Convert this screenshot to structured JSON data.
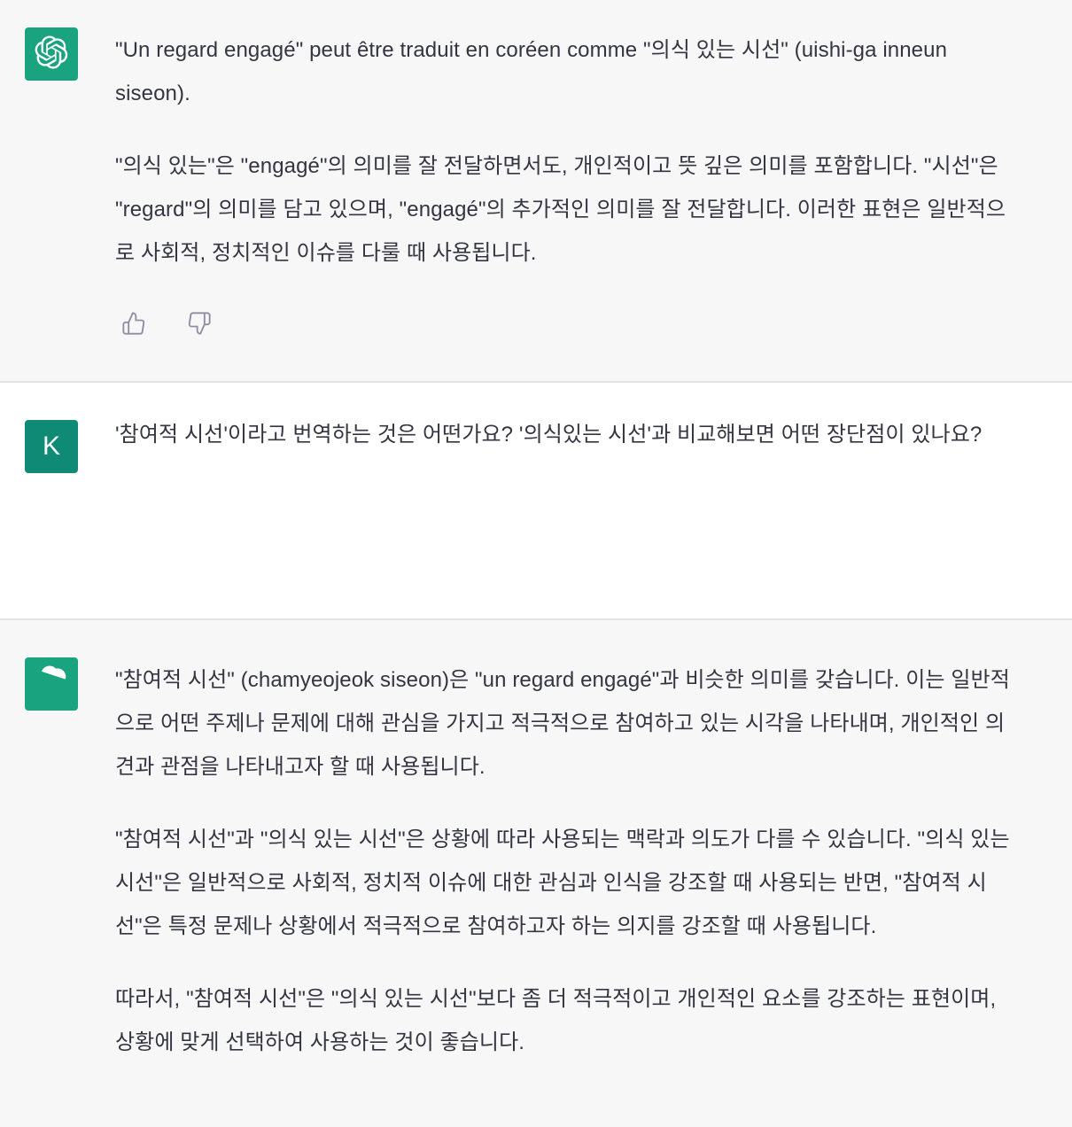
{
  "conversation": {
    "messages": [
      {
        "role": "assistant",
        "avatar_icon": "openai-logo-icon",
        "paragraphs": [
          "\"Un regard engagé\" peut être traduit en coréen comme \"의식 있는 시선\" (uishi-ga inneun siseon).",
          "\"의식 있는\"은 \"engagé\"의 의미를 잘 전달하면서도, 개인적이고 뜻 깊은 의미를 포함합니다. \"시선\"은 \"regard\"의 의미를 담고 있으며, \"engagé\"의 추가적인 의미를 잘 전달합니다. 이러한 표현은 일반적으로 사회적, 정치적인 이슈를 다룰 때 사용됩니다."
        ],
        "feedback_icons": [
          "thumbs-up-icon",
          "thumbs-down-icon"
        ]
      },
      {
        "role": "user",
        "avatar_letter": "K",
        "paragraphs": [
          "'참여적 시선'이라고 번역하는 것은 어떤가요? '의식있는 시선'과 비교해보면 어떤 장단점이 있나요?"
        ]
      },
      {
        "role": "assistant",
        "avatar_icon": "openai-logo-icon",
        "paragraphs": [
          "\"참여적 시선\" (chamyeojeok siseon)은 \"un regard engagé\"과 비슷한 의미를 갖습니다. 이는 일반적으로 어떤 주제나 문제에 대해 관심을 가지고 적극적으로 참여하고 있는 시각을 나타내며, 개인적인 의견과 관점을 나타내고자 할 때 사용됩니다.",
          "\"참여적 시선\"과 \"의식 있는 시선\"은 상황에 따라 사용되는 맥락과 의도가 다를 수 있습니다. \"의식 있는 시선\"은 일반적으로 사회적, 정치적 이슈에 대한 관심과 인식을 강조할 때 사용되는 반면, \"참여적 시선\"은 특정 문제나 상황에서 적극적으로 참여하고자 하는 의지를 강조할 때 사용됩니다.",
          "따라서, \"참여적 시선\"은 \"의식 있는 시선\"보다 좀 더 적극적이고 개인적인 요소를 강조하는 표현이며, 상황에 맞게 선택하여 사용하는 것이 좋습니다."
        ]
      }
    ]
  },
  "colors": {
    "assistant_bg": "#f7f7f8",
    "user_bg": "#ffffff",
    "assistant_avatar": "#19a37f",
    "user_avatar": "#0f8a74",
    "text": "#343541"
  }
}
